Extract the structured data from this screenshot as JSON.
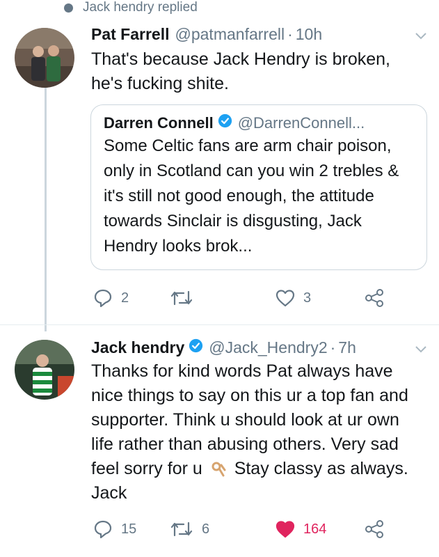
{
  "context": {
    "text": "Jack hendry replied"
  },
  "tweets": [
    {
      "name": "Pat Farrell",
      "handle": "@patmanfarrell",
      "time": "10h",
      "text": "That's because Jack Hendry is broken, he's fucking shite.",
      "quote": {
        "name": "Darren Connell",
        "handle": "@DarrenConnell...",
        "text": "Some Celtic fans are arm chair poison, only in Scotland can you win 2 trebles & it's still not good enough, the attitude towards Sinclair is disgusting, Jack Hendry looks brok..."
      },
      "actions": {
        "replies": "2",
        "retweets": "",
        "likes": "3"
      }
    },
    {
      "name": "Jack hendry",
      "handle": "@Jack_Hendry2",
      "time": "7h",
      "text_part1": "Thanks for kind words Pat always have nice things to say on this ur a top fan and supporter. Think u should look at ur own life rather than abusing others. Very sad feel sorry for u",
      "text_emoji": "👌",
      "text_part2": "Stay classy as always. Jack",
      "actions": {
        "replies": "15",
        "retweets": "6",
        "likes": "164"
      }
    }
  ],
  "colors": {
    "secondary": "#657786",
    "verified": "#1da1f2",
    "like": "#e0245e",
    "border": "#ccd6dd"
  },
  "icons": [
    "reply-icon",
    "retweet-icon",
    "like-icon",
    "share-icon",
    "verified-icon",
    "chevron-down-icon"
  ]
}
